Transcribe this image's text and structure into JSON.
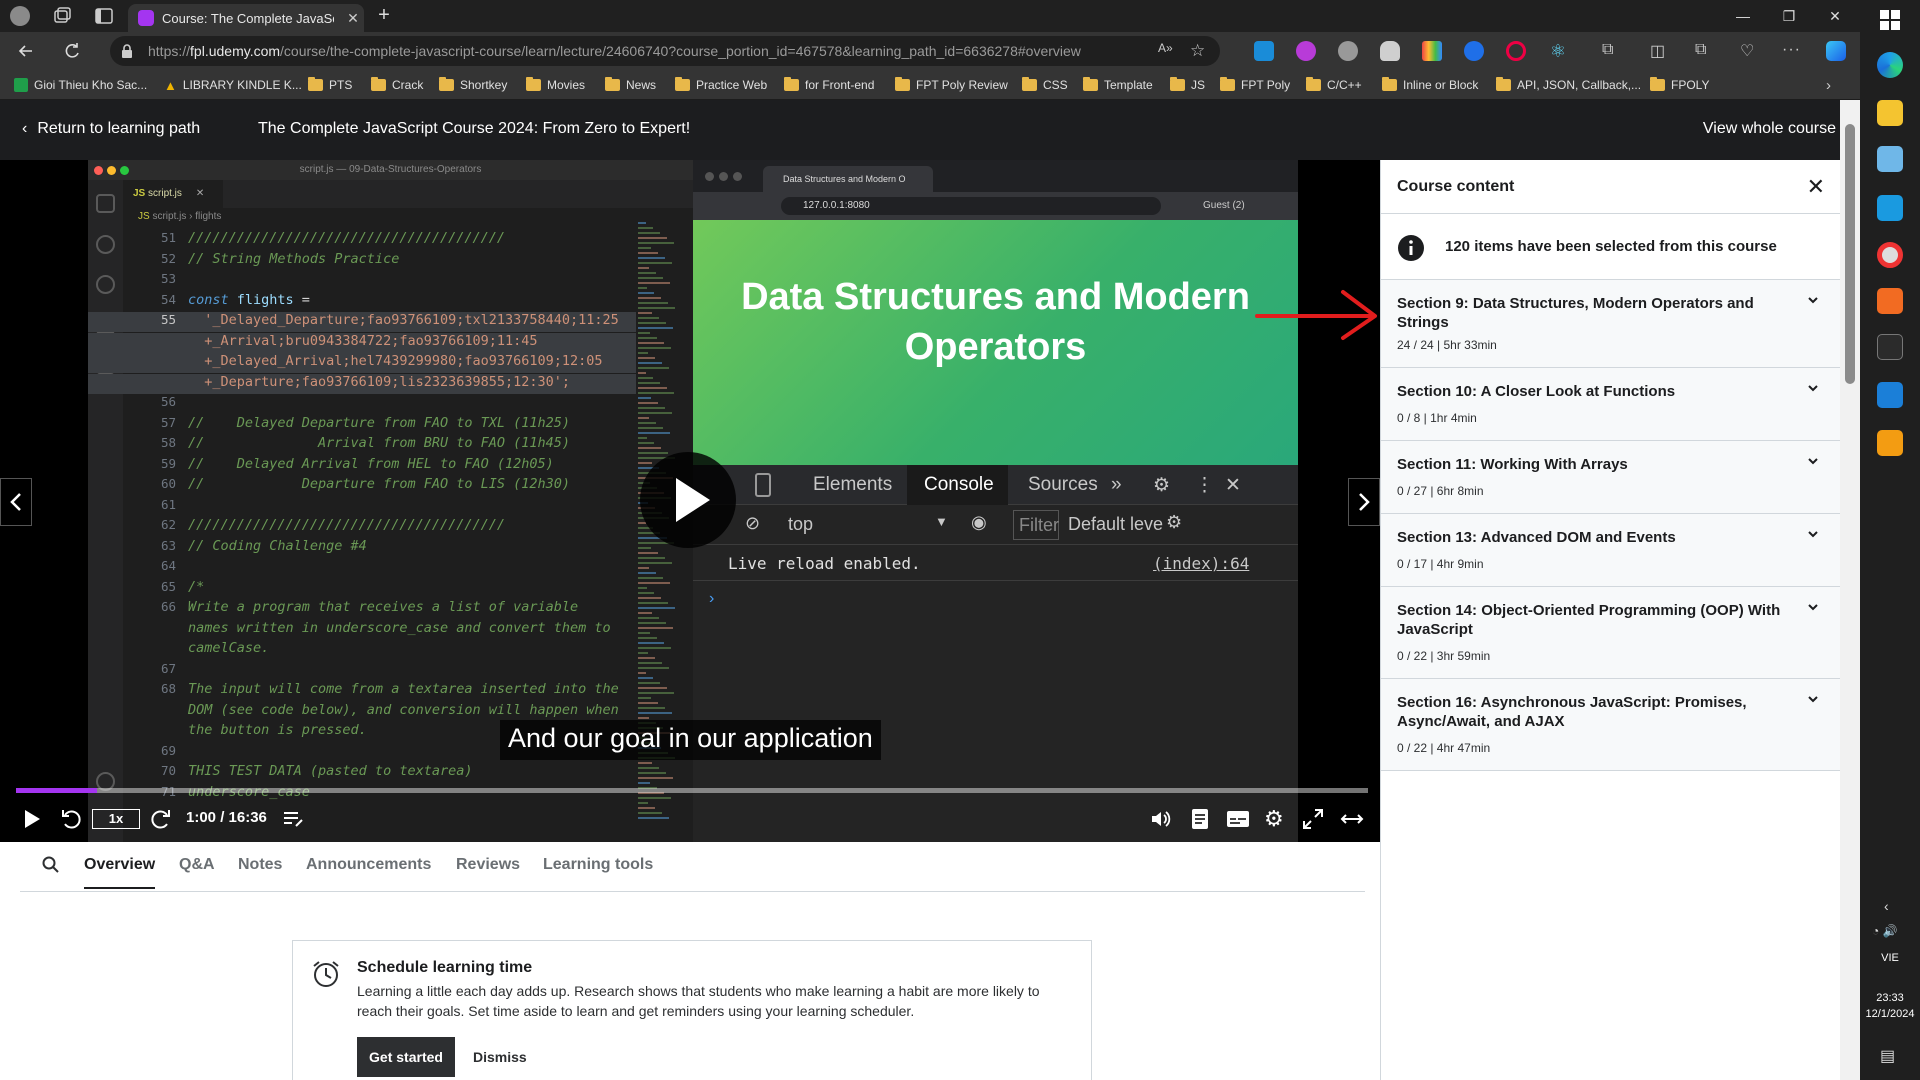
{
  "browser": {
    "tab_title": "Course: The Complete JavaScript",
    "url_prefix": "https://",
    "url_domain": "fpl.udemy.com",
    "url_path": "/course/the-complete-javascript-course/learn/lecture/24606740?course_portion_id=467578&learning_path_id=6636278#overview"
  },
  "bookmarks": [
    "Gioi Thieu Kho Sac...",
    "LIBRARY KINDLE K...",
    "PTS",
    "Crack",
    "Shortkey",
    "Movies",
    "News",
    "Practice Web",
    "for Front-end",
    "FPT Poly Review",
    "CSS",
    "Template",
    "JS",
    "FPT Poly",
    "C/C++",
    "Inline or Block",
    "API, JSON, Callback,...",
    "FPOLY"
  ],
  "header": {
    "return_label": "Return to learning path",
    "course_title": "The Complete JavaScript Course 2024: From Zero to Expert!",
    "view_whole": "View whole course"
  },
  "video": {
    "editor_window_title": "script.js — 09-Data-Structures-Operators",
    "editor_tab": "script.js",
    "breadcrumb_file": "script.js",
    "breadcrumb_symbol": "flights",
    "code_lines": [
      {
        "n": "51",
        "text": "///////////////////////////////////////"
      },
      {
        "n": "52",
        "text": "// String Methods Practice"
      },
      {
        "n": "53",
        "text": ""
      },
      {
        "n": "54",
        "kw": "const",
        "var": " flights",
        "op": " ="
      },
      {
        "n": "55",
        "text": "  '_Delayed_Departure;fao93766109;txl2133758440;11:25"
      },
      {
        "n": "",
        "text": "  +_Arrival;bru0943384722;fao93766109;11:45"
      },
      {
        "n": "",
        "text": "  +_Delayed_Arrival;hel7439299980;fao93766109;12:05"
      },
      {
        "n": "",
        "text": "  +_Departure;fao93766109;lis2323639855;12:30';"
      },
      {
        "n": "56",
        "text": ""
      },
      {
        "n": "57",
        "text": "//    Delayed Departure from FAO to TXL (11h25)"
      },
      {
        "n": "58",
        "text": "//              Arrival from BRU to FAO (11h45)"
      },
      {
        "n": "59",
        "text": "//    Delayed Arrival from HEL to FAO (12h05)"
      },
      {
        "n": "60",
        "text": "//            Departure from FAO to LIS (12h30)"
      },
      {
        "n": "61",
        "text": ""
      },
      {
        "n": "62",
        "text": "///////////////////////////////////////"
      },
      {
        "n": "63",
        "text": "// Coding Challenge #4"
      },
      {
        "n": "64",
        "text": ""
      },
      {
        "n": "65",
        "text": "/*"
      },
      {
        "n": "66",
        "text": "Write a program that receives a list of variable"
      },
      {
        "n": "",
        "text": "names written in underscore_case and convert them to"
      },
      {
        "n": "",
        "text": "camelCase."
      },
      {
        "n": "67",
        "text": ""
      },
      {
        "n": "68",
        "text": "The input will come from a textarea inserted into the"
      },
      {
        "n": "",
        "text": "DOM (see code below), and conversion will happen when"
      },
      {
        "n": "",
        "text": "the button is pressed."
      },
      {
        "n": "69",
        "text": ""
      },
      {
        "n": "70",
        "text": "THIS TEST DATA (pasted to textarea)"
      },
      {
        "n": "71",
        "text": "underscore_case"
      }
    ],
    "inner_browser_tab": "Data Structures and Modern O",
    "inner_browser_url": "127.0.0.1:8080",
    "inner_browser_profile": "Guest (2)",
    "slide_title_line1": "Data Structures and Modern",
    "slide_title_line2": "Operators",
    "devtools_tabs": [
      "Elements",
      "Console",
      "Sources"
    ],
    "context": "top",
    "filter_placeholder": "Filter",
    "levels": "Default leve",
    "log_message": "Live reload enabled.",
    "log_source": "(index):64",
    "subtitle": "And our goal in our application",
    "speed": "1x",
    "time": "1:00 / 16:36",
    "progress": 0.06
  },
  "lower_tabs": [
    "Overview",
    "Q&A",
    "Notes",
    "Announcements",
    "Reviews",
    "Learning tools"
  ],
  "schedule": {
    "title": "Schedule learning time",
    "body": "Learning a little each day adds up. Research shows that students who make learning a habit are more likely to reach their goals. Set time aside to learn and get reminders using your learning scheduler.",
    "get_started": "Get started",
    "dismiss": "Dismiss"
  },
  "sidebar": {
    "title": "Course content",
    "info": "120 items have been selected from this course",
    "sections": [
      {
        "title": "Section 9: Data Structures, Modern Operators and Strings",
        "meta": "24 / 24 | 5hr 33min"
      },
      {
        "title": "Section 10: A Closer Look at Functions",
        "meta": "0 / 8 | 1hr 4min"
      },
      {
        "title": "Section 11: Working With Arrays",
        "meta": "0 / 27 | 6hr 8min"
      },
      {
        "title": "Section 13: Advanced DOM and Events",
        "meta": "0 / 17 | 4hr 9min"
      },
      {
        "title": "Section 14: Object-Oriented Programming (OOP) With JavaScript",
        "meta": "0 / 22 | 3hr 59min"
      },
      {
        "title": "Section 16: Asynchronous JavaScript: Promises, Async/Await, and AJAX",
        "meta": "0 / 22 | 4hr 47min"
      }
    ]
  },
  "taskbar": {
    "lang": "VIE",
    "time": "23:33",
    "date": "12/1/2024"
  },
  "colors": {
    "accent": "#a435f0",
    "annotation_arrow": "#e11d1d"
  }
}
